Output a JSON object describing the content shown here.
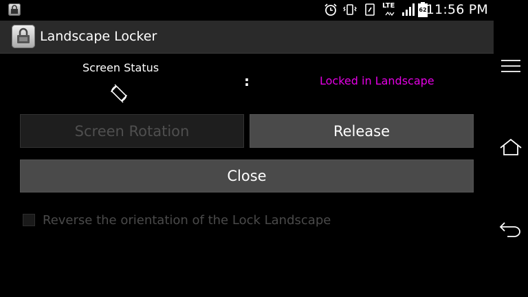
{
  "status_bar": {
    "time": "11:56 PM",
    "network": "LTE",
    "battery_level": "62",
    "icons": [
      "app-notification-icon",
      "alarm-icon",
      "vibrate-icon",
      "nfc-icon",
      "lte-icon",
      "signal-icon",
      "battery-icon"
    ]
  },
  "action_bar": {
    "title": "Landscape Locker",
    "icon": "lock-app-icon"
  },
  "status_row": {
    "label": "Screen Status",
    "separator": ":",
    "value": "Locked in Landscape",
    "icon": "screen-rotation-icon"
  },
  "buttons": {
    "screen_rotation": "Screen Rotation",
    "release": "Release",
    "close": "Close"
  },
  "option": {
    "label": "Reverse the orientation of the Lock Landscape",
    "checked": false
  },
  "nav": {
    "icons": [
      "menu-icon",
      "home-icon",
      "back-icon"
    ]
  },
  "colors": {
    "status_value": "#e600e6",
    "button_enabled": "#4a4a4a",
    "button_disabled": "#1e1e1e",
    "action_bar": "#2a2a2a"
  }
}
